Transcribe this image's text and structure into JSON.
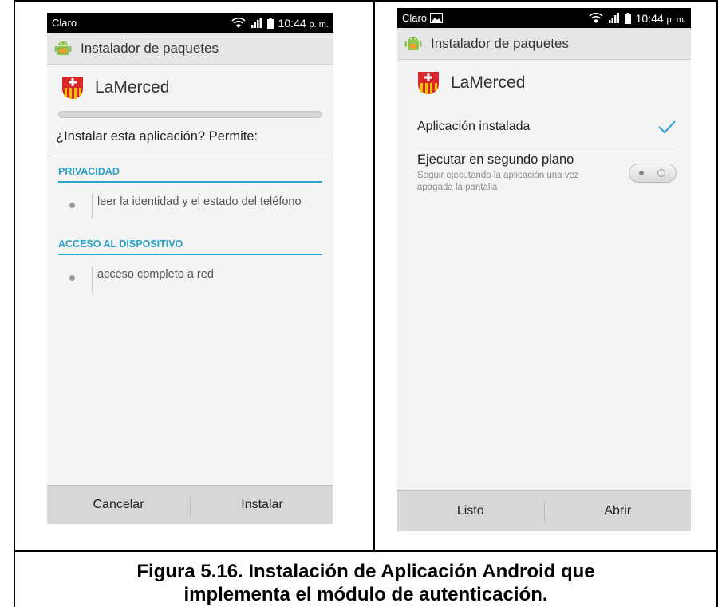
{
  "left_screen": {
    "status": {
      "carrier": "Claro",
      "time": "10:44",
      "ampm": "p. m."
    },
    "header": {
      "title": "Instalador de paquetes",
      "icon": "android-package-icon"
    },
    "app": {
      "name": "LaMerced",
      "icon": "lamerced-shield-icon"
    },
    "question": "¿Instalar esta aplicación? Permite:",
    "sections": [
      {
        "heading": "PRIVACIDAD",
        "items": [
          "leer la identidad y el estado del teléfono"
        ]
      },
      {
        "heading": "ACCESO AL DISPOSITIVO",
        "items": [
          "acceso completo a red"
        ]
      }
    ],
    "buttons": {
      "cancel": "Cancelar",
      "install": "Instalar"
    }
  },
  "right_screen": {
    "status": {
      "carrier": "Claro",
      "time": "10:44",
      "ampm": "p. m."
    },
    "header": {
      "title": "Instalador de paquetes",
      "icon": "android-package-icon"
    },
    "app": {
      "name": "LaMerced",
      "icon": "lamerced-shield-icon"
    },
    "installed_label": "Aplicación instalada",
    "background_option": {
      "title": "Ejecutar en segundo plano",
      "subtitle": "Seguir ejecutando la aplicación una vez apagada la pantalla",
      "enabled": false
    },
    "buttons": {
      "done": "Listo",
      "open": "Abrir"
    }
  },
  "caption": {
    "line1": "Figura 5.16. Instalación de Aplicación Android que",
    "line2": "implementa el módulo de autenticación."
  },
  "colors": {
    "accent": "#2aa1c9",
    "check": "#3aa5d3",
    "android_green": "#8bc34a",
    "shield_red": "#d9262b",
    "shield_yellow": "#f2c200"
  }
}
